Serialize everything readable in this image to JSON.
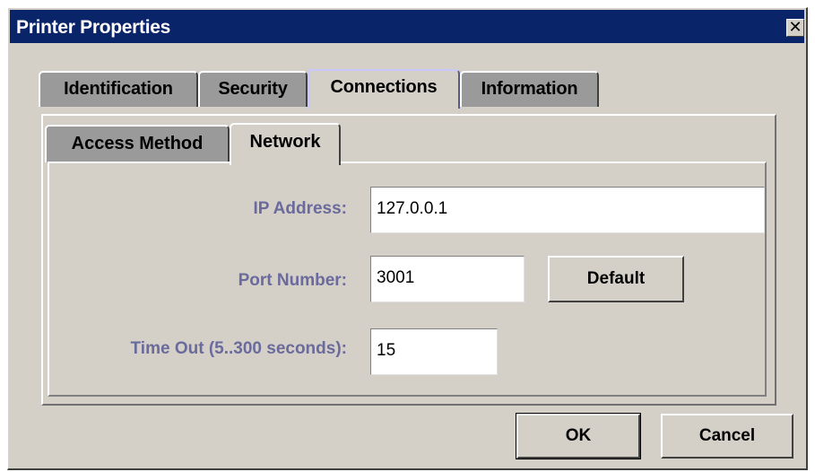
{
  "window": {
    "title": "Printer Properties",
    "close_glyph": "✕"
  },
  "outer_tabs": [
    {
      "label": "Identification",
      "selected": false
    },
    {
      "label": "Security",
      "selected": false
    },
    {
      "label": "Connections",
      "selected": true
    },
    {
      "label": "Information",
      "selected": false
    }
  ],
  "inner_tabs": [
    {
      "label": "Access Method",
      "selected": false
    },
    {
      "label": "Network",
      "selected": true
    }
  ],
  "network": {
    "ip_label": "IP Address:",
    "ip_value": "127.0.0.1",
    "port_label": "Port Number:",
    "port_value": "3001",
    "default_button": "Default",
    "timeout_label": "Time Out (5..300 seconds):",
    "timeout_value": "15"
  },
  "footer": {
    "ok_mnemonic": "O",
    "ok_rest": "K",
    "cancel_mnemonic": "C",
    "cancel_rest": "ancel"
  },
  "colors": {
    "titlebar": "#0a246a",
    "dialog_bg": "#d4d0c8",
    "label": "#6a6a9c",
    "unselected_tab": "#9a9a9a"
  },
  "icons": {
    "close": "close-icon"
  }
}
